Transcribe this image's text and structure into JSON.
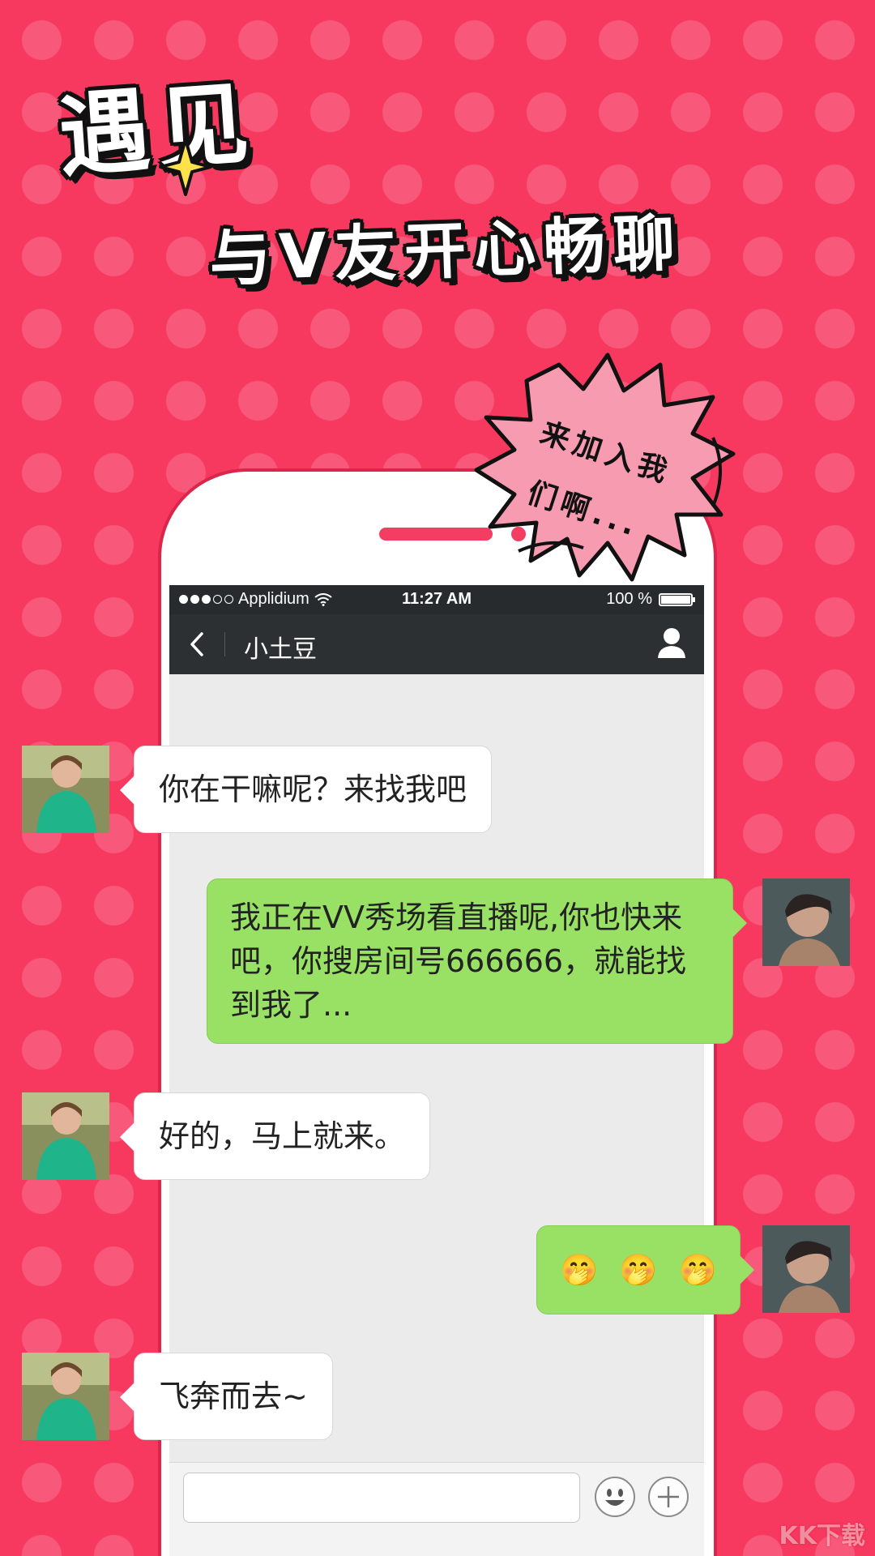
{
  "headline": {
    "line1": "遇见",
    "line2": "与V友开心畅聊"
  },
  "burst": {
    "line1": "来加入我",
    "line2": "们啊..."
  },
  "status_bar": {
    "carrier": "Applidium",
    "time": "11:27 AM",
    "battery": "100 %",
    "signal_bars_filled": 3,
    "signal_bars_total": 5
  },
  "nav": {
    "back_icon": "chevron-left-icon",
    "title": "小土豆",
    "profile_icon": "user-icon"
  },
  "messages": [
    {
      "direction": "in",
      "text": "你在干嘛呢？来找我吧"
    },
    {
      "direction": "out",
      "text": "我正在VV秀场看直播呢,你也快来吧，你搜房间号666666，就能找到我了..."
    },
    {
      "direction": "in",
      "text": "好的，马上就来。"
    },
    {
      "direction": "out",
      "emoji": [
        "🤭",
        "🤭",
        "🤭"
      ]
    },
    {
      "direction": "in",
      "text": "飞奔而去~"
    }
  ],
  "input": {
    "value": "",
    "emoji_icon": "smiley-icon",
    "plus_icon": "plus-icon"
  },
  "watermark": "KK下载",
  "colors": {
    "background": "#f7385f",
    "bubble_out": "#98e165",
    "bubble_in": "#ffffff",
    "navbar": "#2c3032",
    "accent": "#f43d63"
  }
}
